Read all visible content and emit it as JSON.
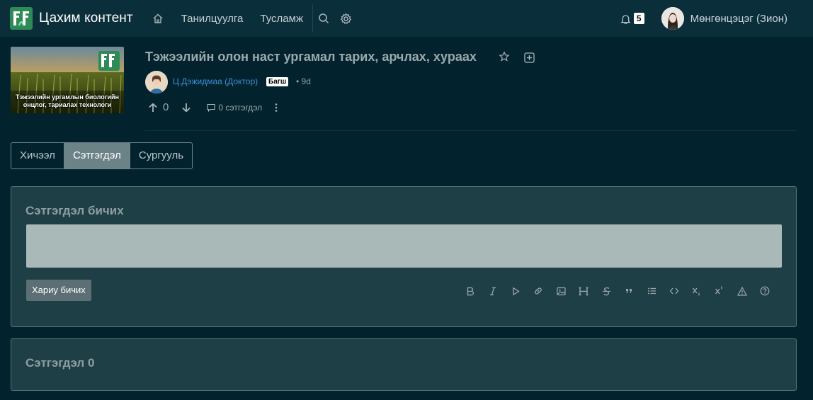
{
  "navbar": {
    "brand_name": "Цахим контент",
    "links": [
      "Танилцуулга",
      "Тусламж"
    ],
    "notification_count": "5",
    "user_name": "Мөнгөнцэцэг (Зион)"
  },
  "post": {
    "thumbnail_caption_line1": "Тэжээлийн ургамлын биологийн",
    "thumbnail_caption_line2": "онцлог, тариалах технологи",
    "title": "Тэжээлийн олон наст ургамал тарих, арчлах, хураах",
    "author": "Ц.Дэжидмаа (Доктор)",
    "author_role": "Багш",
    "time": "9d",
    "votes": "0",
    "comments_label": "0 сэтгэгдэл"
  },
  "tabs": [
    {
      "label": "Хичээл",
      "active": false
    },
    {
      "label": "Сэтгэгдэл",
      "active": true
    },
    {
      "label": "Сургууль",
      "active": false
    }
  ],
  "write_panel": {
    "title": "Сэтгэгдэл бичих",
    "reply_button": "Хариу бичих",
    "toolbar": [
      "bold-icon",
      "italic-icon",
      "video-icon",
      "link-icon",
      "image-icon",
      "heading-icon",
      "strikethrough-icon",
      "quote-icon",
      "list-icon",
      "code-icon",
      "subscript-icon",
      "superscript-icon",
      "warning-icon",
      "help-icon"
    ]
  },
  "comments_panel": {
    "title": "Сэтгэгдэл 0"
  },
  "colors": {
    "background": "#02232e",
    "navbar": "#0b2f3a",
    "panel": "#1f3f46",
    "link": "#3d8fd8",
    "active_tab": "#6b8287"
  }
}
